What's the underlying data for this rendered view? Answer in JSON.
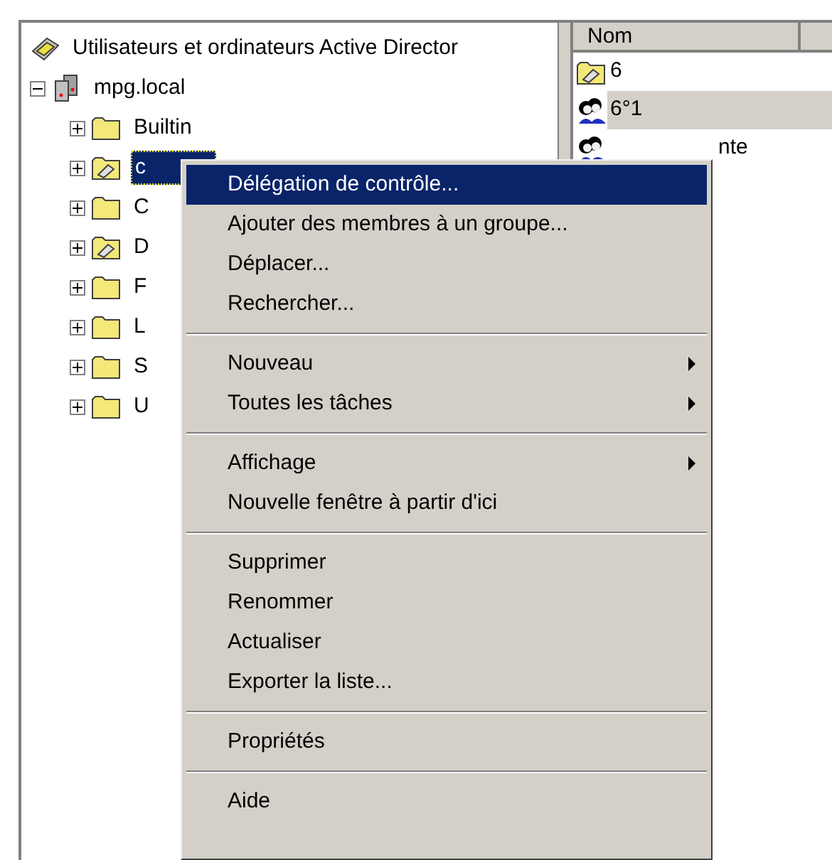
{
  "tree": {
    "label": "Utilisateurs et ordinateurs Active Director",
    "kind": "console",
    "children": [
      {
        "label": "mpg.local",
        "kind": "domain",
        "expanded": true,
        "children": [
          {
            "label": "Builtin",
            "kind": "folder",
            "expanded": false,
            "selected": false
          },
          {
            "label": "c",
            "kind": "ou-folder",
            "expanded": false,
            "selected": true
          },
          {
            "label": "C",
            "kind": "folder",
            "expanded": false,
            "selected": false
          },
          {
            "label": "D",
            "kind": "ou-folder",
            "expanded": false,
            "selected": false
          },
          {
            "label": "F",
            "kind": "folder",
            "expanded": false,
            "selected": false
          },
          {
            "label": "L",
            "kind": "folder",
            "expanded": false,
            "selected": false
          },
          {
            "label": "S",
            "kind": "folder",
            "expanded": false,
            "selected": false
          },
          {
            "label": "U",
            "kind": "folder",
            "expanded": false,
            "selected": false
          }
        ]
      }
    ]
  },
  "list": {
    "columns": [
      "Nom"
    ],
    "rows": [
      {
        "label": "6",
        "kind": "ou-folder",
        "selected": false
      },
      {
        "label": "6°1",
        "kind": "group",
        "selected": true
      },
      {
        "label": "nte",
        "kind": "group",
        "selected": false
      }
    ]
  },
  "context_menu": [
    {
      "kind": "item",
      "label": "Délégation de contrôle...",
      "selected": true,
      "submenu": false
    },
    {
      "kind": "item",
      "label": "Ajouter des membres à un groupe...",
      "selected": false,
      "submenu": false
    },
    {
      "kind": "item",
      "label": "Déplacer...",
      "selected": false,
      "submenu": false
    },
    {
      "kind": "item",
      "label": "Rechercher...",
      "selected": false,
      "submenu": false
    },
    {
      "kind": "separator"
    },
    {
      "kind": "item",
      "label": "Nouveau",
      "selected": false,
      "submenu": true
    },
    {
      "kind": "item",
      "label": "Toutes les tâches",
      "selected": false,
      "submenu": true
    },
    {
      "kind": "separator"
    },
    {
      "kind": "item",
      "label": "Affichage",
      "selected": false,
      "submenu": true
    },
    {
      "kind": "item",
      "label": "Nouvelle fenêtre à partir d'ici",
      "selected": false,
      "submenu": false
    },
    {
      "kind": "separator"
    },
    {
      "kind": "item",
      "label": "Supprimer",
      "selected": false,
      "submenu": false
    },
    {
      "kind": "item",
      "label": "Renommer",
      "selected": false,
      "submenu": false
    },
    {
      "kind": "item",
      "label": "Actualiser",
      "selected": false,
      "submenu": false
    },
    {
      "kind": "item",
      "label": "Exporter la liste...",
      "selected": false,
      "submenu": false
    },
    {
      "kind": "separator"
    },
    {
      "kind": "item",
      "label": "Propriétés",
      "selected": false,
      "submenu": false
    },
    {
      "kind": "separator"
    },
    {
      "kind": "item",
      "label": "Aide",
      "selected": false,
      "submenu": false
    }
  ]
}
